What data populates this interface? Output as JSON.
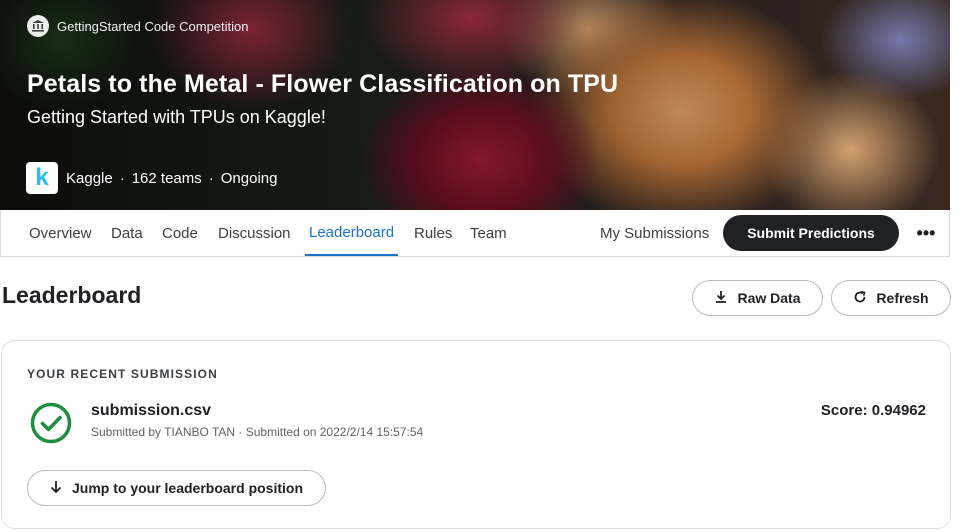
{
  "hero": {
    "competition_type": "GettingStarted Code Competition",
    "title": "Petals to the Metal - Flower Classification on TPU",
    "subtitle": "Getting Started with TPUs on Kaggle!",
    "host_logo_letter": "k",
    "host": "Kaggle",
    "teams": "162 teams",
    "status": "Ongoing"
  },
  "tabs": [
    {
      "label": "Overview",
      "active": false
    },
    {
      "label": "Data",
      "active": false
    },
    {
      "label": "Code",
      "active": false
    },
    {
      "label": "Discussion",
      "active": false
    },
    {
      "label": "Leaderboard",
      "active": true
    },
    {
      "label": "Rules",
      "active": false
    },
    {
      "label": "Team",
      "active": false
    }
  ],
  "actions": {
    "my_submissions": "My Submissions",
    "submit_predictions": "Submit Predictions",
    "more": "•••"
  },
  "leaderboard": {
    "title": "Leaderboard",
    "raw_data_label": "Raw Data",
    "refresh_label": "Refresh"
  },
  "recent_submission": {
    "label": "YOUR RECENT SUBMISSION",
    "file_name": "submission.csv",
    "meta": "Submitted by TIANBO TAN · Submitted on 2022/2/14 15:57:54",
    "score": "Score: 0.94962",
    "jump_label": "Jump to your leaderboard position"
  },
  "colors": {
    "accent_blue": "#1a73c8",
    "kaggle_blue": "#20beff",
    "success_green": "#1e8e3e",
    "dark_button": "#202124"
  },
  "icons": {
    "competition_type": "bank-icon",
    "raw_data": "download-icon",
    "refresh": "refresh-icon",
    "submission_status": "check-circle-icon",
    "jump": "arrow-down-icon"
  }
}
